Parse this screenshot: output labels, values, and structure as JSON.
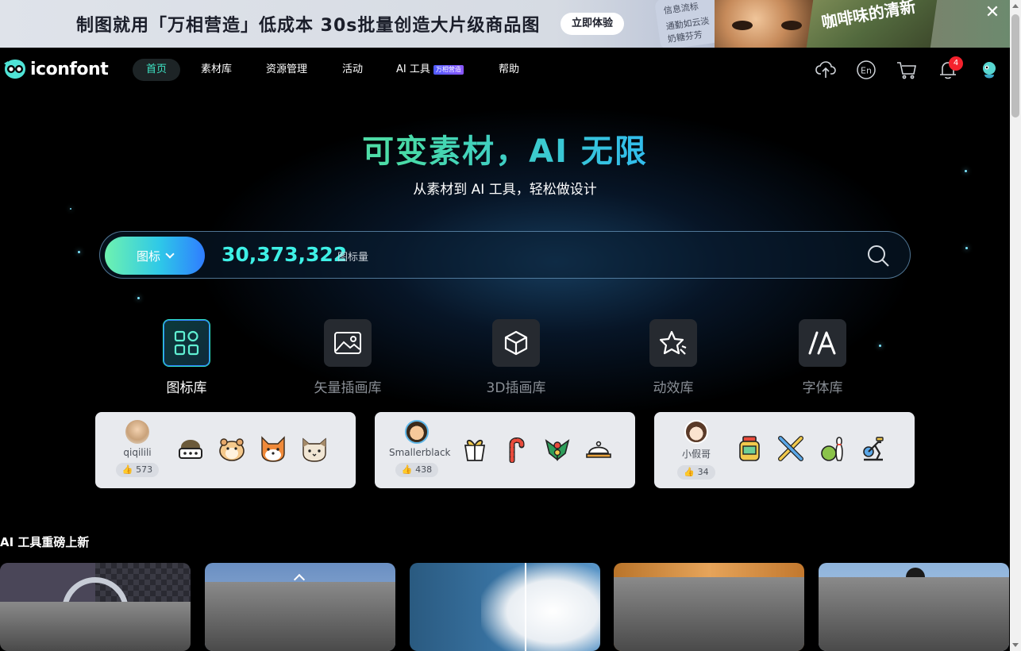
{
  "banner": {
    "headline": "制图就用「万相营造」低成本 30s批量创造大片级商品图",
    "cta": "立即体验",
    "card_line1": "信息流标",
    "card_line2": "通勤如云淡",
    "card_line3": "奶糖芬芳",
    "coffee_text": "咖啡味的清新",
    "close_icon": "close-icon"
  },
  "nav": {
    "logo": "iconfont",
    "items": [
      {
        "label": "首页",
        "active": true
      },
      {
        "label": "素材库"
      },
      {
        "label": "资源管理"
      },
      {
        "label": "活动"
      },
      {
        "label": "AI 工具",
        "badge": "万相营造"
      },
      {
        "label": "帮助"
      }
    ],
    "upload_icon": "cloud-upload-icon",
    "language": "En",
    "cart_icon": "cart-icon",
    "notification_count": "4",
    "avatar_icon": "avatar-icon"
  },
  "hero": {
    "title": "可变素材，AI 无限",
    "subtitle": "从素材到 AI 工具，轻松做设计"
  },
  "search": {
    "type_label": "图标",
    "count": "30,373,322",
    "count_unit": "图标量",
    "icon": "search-icon"
  },
  "categories": [
    {
      "label": "图标库",
      "icon": "grid-icon",
      "active": true
    },
    {
      "label": "矢量插画库",
      "icon": "image-icon"
    },
    {
      "label": "3D插画库",
      "icon": "cube-icon"
    },
    {
      "label": "动效库",
      "icon": "star-icon"
    },
    {
      "label": "字体库",
      "icon": "font-icon"
    }
  ],
  "showcase": [
    {
      "author": "qiqilili",
      "likes": "573",
      "icons": [
        "turtle-icon",
        "hamster-icon",
        "shiba-icon",
        "cat-icon"
      ]
    },
    {
      "author": "Smallerblack",
      "likes": "438",
      "icons": [
        "gift-icon",
        "candy-cane-icon",
        "holly-icon",
        "dish-icon"
      ]
    },
    {
      "author": "小假哥",
      "likes": "34",
      "icons": [
        "jar-icon",
        "bats-icon",
        "bowling-icon",
        "exercise-bike-icon"
      ]
    }
  ],
  "ai_tools": {
    "title": "AI 工具重磅上新"
  },
  "colors": {
    "accent_green": "#3ee6c6",
    "accent_blue": "#2f7dff",
    "badge_red": "#f5222d"
  }
}
